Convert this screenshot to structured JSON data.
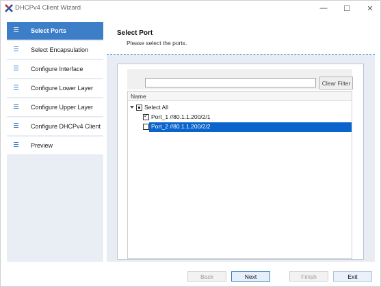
{
  "window": {
    "title": "DHCPv4 Client Wizard",
    "minimize_glyph": "—",
    "maximize_glyph": "☐",
    "close_glyph": "✕",
    "accent_color": "#3d7ec9",
    "selection_color": "#0a64cc"
  },
  "sidebar": {
    "items": [
      {
        "label": "Select Ports",
        "active": true
      },
      {
        "label": "Select Encapsulation",
        "active": false
      },
      {
        "label": "Configure Interface",
        "active": false
      },
      {
        "label": "Configure Lower Layer",
        "active": false
      },
      {
        "label": "Configure Upper Layer",
        "active": false
      },
      {
        "label": "Configure DHCPv4 Client",
        "active": false
      },
      {
        "label": "Preview",
        "active": false
      }
    ]
  },
  "page": {
    "title": "Select Port",
    "subtitle": "Please select the ports."
  },
  "filter": {
    "value": "",
    "placeholder": "",
    "button_label": "Clear Filter"
  },
  "tree": {
    "column_header": "Name",
    "root": {
      "label": "Select All",
      "state": "partial",
      "expanded": true
    },
    "children": [
      {
        "label": "Port_1 //80.1.1.200/2/1",
        "checked": true,
        "selected": false
      },
      {
        "label": "Port_2 //80.1.1.200/2/2",
        "checked": false,
        "selected": true
      }
    ]
  },
  "footer": {
    "back_label": "Back",
    "next_label": "Next",
    "finish_label": "Finish",
    "exit_label": "Exit"
  }
}
